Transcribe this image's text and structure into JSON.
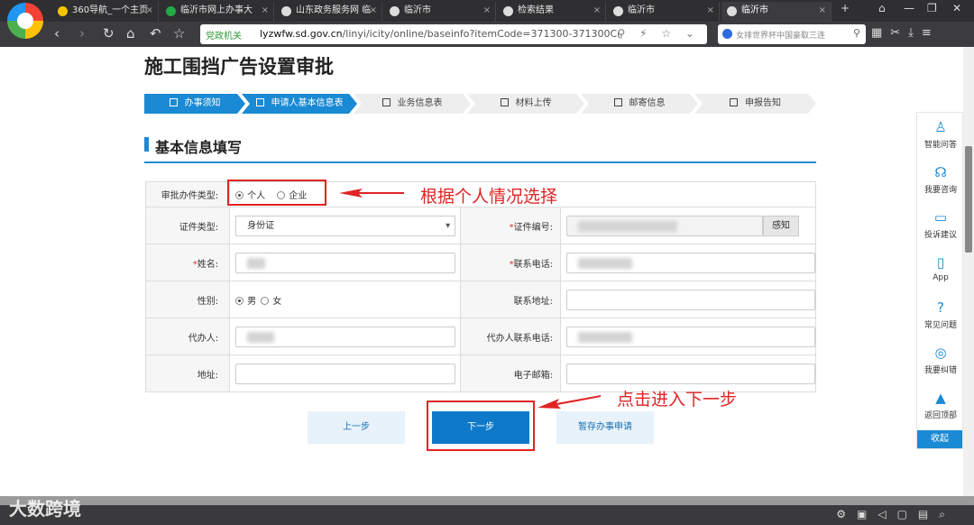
{
  "browser": {
    "tabs": [
      {
        "label": "360导航_一个主页",
        "icon_color": "#f5c400",
        "active": false
      },
      {
        "label": "临沂市网上办事大",
        "icon_color": "#22aa44",
        "active": false
      },
      {
        "label": "山东政务服务网 临",
        "icon_color": "#dddddd",
        "active": false
      },
      {
        "label": "临沂市",
        "icon_color": "#dddddd",
        "active": false
      },
      {
        "label": "检索结果",
        "icon_color": "#dddddd",
        "active": false
      },
      {
        "label": "临沂市",
        "icon_color": "#dddddd",
        "active": false
      },
      {
        "label": "临沂市",
        "icon_color": "#dddddd",
        "active": true
      }
    ],
    "url_badge": "党政机关",
    "url_host": "lyzwfw.sd.gov.cn",
    "url_path": "/linyi/icity/online/baseinfo?itemCode=371300-371300C(",
    "search_placeholder": "女排世界杯中国豪取三连"
  },
  "page": {
    "title": "施工围挡广告设置审批",
    "steps": [
      {
        "label": "办事须知",
        "active": true
      },
      {
        "label": "申请人基本信息表",
        "active": true
      },
      {
        "label": "业务信息表",
        "active": false
      },
      {
        "label": "材料上传",
        "active": false
      },
      {
        "label": "邮寄信息",
        "active": false
      },
      {
        "label": "申报告知",
        "active": false
      }
    ],
    "section_title": "基本信息填写"
  },
  "form": {
    "applicant_type_label": "审批办件类型:",
    "applicant_type_options": [
      "个人",
      "企业"
    ],
    "id_type_label": "证件类型:",
    "id_type_value": "身份证",
    "id_number_label": "证件编号:",
    "sense_button": "感知",
    "name_label": "姓名:",
    "phone_label": "联系电话:",
    "gender_label": "性别:",
    "gender_options": [
      "男",
      "女"
    ],
    "address_label": "联系地址:",
    "agent_label": "代办人:",
    "agent_phone_label": "代办人联系电话:",
    "addr_label": "地址:",
    "email_label": "电子邮箱:",
    "required_mark": "*"
  },
  "buttons": {
    "prev": "上一步",
    "next": "下一步",
    "save": "暂存办事申请"
  },
  "annotations": {
    "radio_note": "根据个人情况选择",
    "next_note": "点击进入下一步",
    "color": "#e02424"
  },
  "float_bar": {
    "items": [
      "智能问答",
      "我要咨询",
      "投诉建议",
      "App",
      "常见问题",
      "我要纠错",
      "返回顶部"
    ],
    "collapse": "收起"
  },
  "watermark": "大数跨境"
}
